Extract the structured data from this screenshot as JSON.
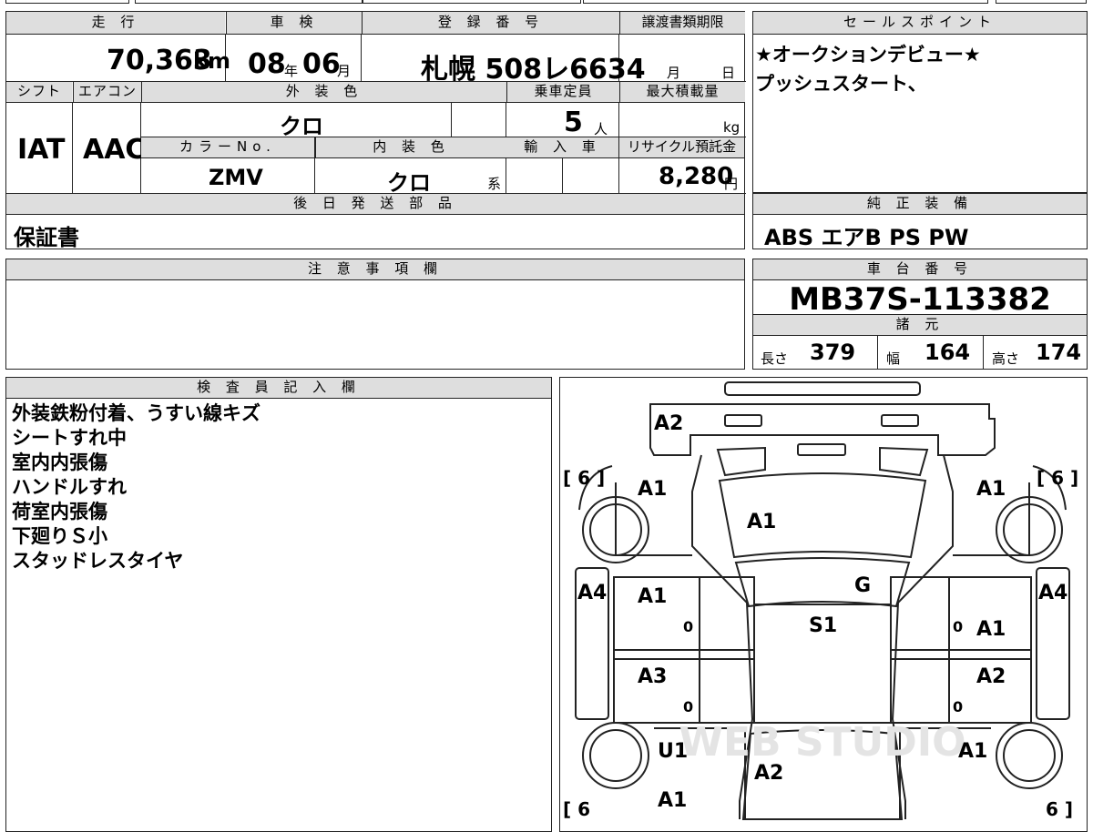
{
  "headers": {
    "mileage": "走 行",
    "inspection": "車 検",
    "registration": "登 録 番 号",
    "transfer_deadline": "譲渡書類期限",
    "sales_point": "セールスポイント",
    "shift": "シフト",
    "aircon": "エアコン",
    "exterior_color": "外 装 色",
    "capacity": "乗車定員",
    "max_load": "最大積載量",
    "color_no": "カラーNo.",
    "interior_color": "内 装 色",
    "import": "輸 入 車",
    "recycle": "リサイクル預託金",
    "later_parts": "後 日 発 送 部 品",
    "genuine_equipment": "純 正 装 備",
    "notes": "注 意 事 項 欄",
    "chassis_no": "車 台 番 号",
    "specs": "諸 元",
    "inspector": "検 査 員 記 入 欄"
  },
  "values": {
    "mileage": "70,363",
    "mileage_unit": "km",
    "inspection_year": "08",
    "year_unit": "年",
    "inspection_month": "06",
    "month_unit": "月",
    "registration_no": "札幌 508レ6634",
    "deadline_month": "月",
    "deadline_day": "日",
    "shift": "IAT",
    "aircon": "AAC",
    "exterior_color": "クロ",
    "capacity": "5",
    "capacity_unit": "人",
    "max_load_unit": "kg",
    "color_no": "ZMV",
    "interior_color": "クロ",
    "interior_suffix": "系",
    "recycle_fee": "8,280",
    "recycle_unit": "円",
    "later_parts": "保証書",
    "genuine_equipment": "ABS エアB PS PW",
    "chassis_no": "MB37S-113382",
    "length_label": "長さ",
    "length": "379",
    "width_label": "幅",
    "width": "164",
    "height_label": "高さ",
    "height": "174"
  },
  "sales_points": [
    "★オークションデビュー★",
    "プッシュスタート、"
  ],
  "inspector_notes": [
    "外装鉄粉付着、うすい線キズ",
    "シートすれ中",
    "室内内張傷",
    "ハンドルすれ",
    "荷室内張傷",
    "下廻りＳ小",
    "スタッドレスタイヤ"
  ],
  "diagram": {
    "tire_left_top": "[ 6 ]",
    "tire_right_top": "[ 6 ]",
    "tire_left_bottom": "[ 6",
    "tire_right_bottom": "6 ]",
    "front_bumper": "A2",
    "fender_fl": "A1",
    "fender_fr": "A1",
    "bonnet": "A1",
    "windshield": "G",
    "roof": "S1",
    "side_l": "A4",
    "side_r": "A4",
    "door_fl": "A1",
    "door_fr": "A1",
    "door_rl": "A3",
    "door_rr": "A2",
    "quarter_rl": "U1",
    "quarter_rr": "A1",
    "back_door": "A2",
    "rear_l": "A1",
    "zero_fl": "0",
    "zero_fr": "0",
    "zero_rl": "0",
    "zero_rr": "0",
    "watermark": "WEB STUDIO"
  }
}
